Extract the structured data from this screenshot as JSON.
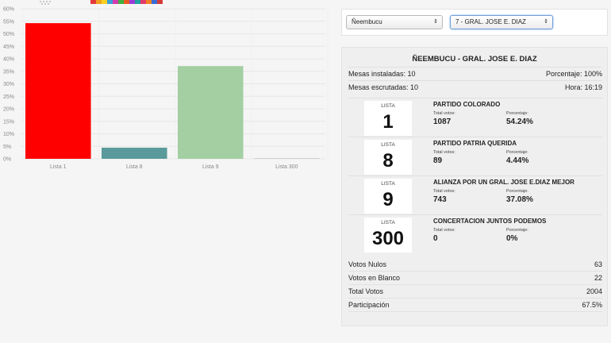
{
  "header": {
    "color_strip": [
      "#e23a3a",
      "#f0a020",
      "#f7d020",
      "#3aa0d8",
      "#d43ab0",
      "#40b040",
      "#e85a20",
      "#9b3ad4",
      "#20a0a0",
      "#e23a6a",
      "#f08020",
      "#3a6ad4",
      "#d43a3a"
    ]
  },
  "chart_data": {
    "type": "bar",
    "categories": [
      "Lista 1",
      "Lista 8",
      "Lista 9",
      "Lista 300"
    ],
    "values": [
      54.24,
      4.44,
      37.08,
      0
    ],
    "colors": [
      "#ff0000",
      "#5a9a9a",
      "#a3cfa3",
      "#c8c8c8"
    ],
    "ylim": [
      0,
      60
    ],
    "yticks": [
      "0%",
      "5%",
      "10%",
      "15%",
      "20%",
      "25%",
      "30%",
      "35%",
      "40%",
      "45%",
      "50%",
      "55%",
      "60%"
    ],
    "grid": true,
    "title": "",
    "xlabel": "",
    "ylabel": ""
  },
  "selects": {
    "department": "Ñeembucu",
    "district": "7 - GRAL. JOSE E. DIAZ"
  },
  "results": {
    "title": "ÑEEMBUCU - GRAL. JOSE E. DIAZ",
    "mesas_instaladas": "Mesas instaladas: 10",
    "porcentaje": "Porcentaje: 100%",
    "mesas_escrutadas": "Mesas escrutadas: 10",
    "hora": "Hora: 16:19",
    "lista_label": "LISTA",
    "total_votos_label": "Total votos:",
    "porcentaje_label": "Porcentaje:",
    "parties": [
      {
        "lista": "1",
        "name": "PARTIDO COLORADO",
        "votes": "1087",
        "percent": "54.24%"
      },
      {
        "lista": "8",
        "name": "PARTIDO PATRIA QUERIDA",
        "votes": "89",
        "percent": "4.44%"
      },
      {
        "lista": "9",
        "name": "ALIANZA POR UN GRAL. JOSE E.DIAZ MEJOR",
        "votes": "743",
        "percent": "37.08%"
      },
      {
        "lista": "300",
        "name": "CONCERTACION JUNTOS PODEMOS",
        "votes": "0",
        "percent": "0%"
      }
    ],
    "summary": [
      {
        "label": "Votos Nulos",
        "value": "63"
      },
      {
        "label": "Votos en Blanco",
        "value": "22"
      },
      {
        "label": "Total Votos",
        "value": "2004"
      },
      {
        "label": "Participación",
        "value": "67.5%"
      }
    ]
  }
}
